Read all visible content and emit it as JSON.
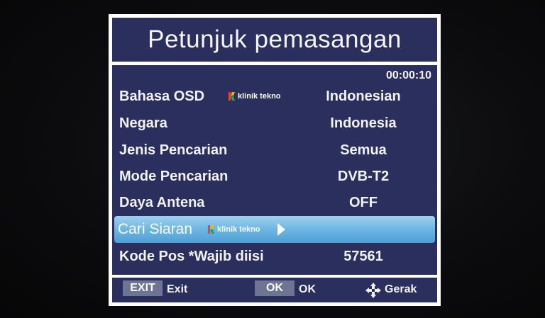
{
  "dialog": {
    "title": "Petunjuk pemasangan",
    "timer": "00:00:10"
  },
  "settings": [
    {
      "label": "Bahasa OSD",
      "value": "Indonesian"
    },
    {
      "label": "Negara",
      "value": "Indonesia"
    },
    {
      "label": "Jenis Pencarian",
      "value": "Semua"
    },
    {
      "label": "Mode Pencarian",
      "value": "DVB-T2"
    },
    {
      "label": "Daya Antena",
      "value": "OFF"
    },
    {
      "label": "Cari Siaran",
      "value": ""
    },
    {
      "label": "Kode Pos *Wajib diisi",
      "value": "57561"
    }
  ],
  "watermark": "klinik tekno",
  "footer": {
    "exit_key": "EXIT",
    "exit_label": "Exit",
    "ok_key": "OK",
    "ok_label": "OK",
    "move_icon": "move-arrows-icon",
    "move_label": "Gerak"
  },
  "colors": {
    "panel": "#2b2f5e",
    "border": "#ffffff",
    "highlight": "#6db6e4",
    "key_bg": "#6e7493"
  }
}
